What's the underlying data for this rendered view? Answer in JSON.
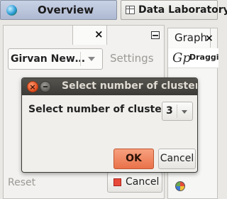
{
  "top_tabs": {
    "overview_label": "Overview",
    "data_laboratory_label": "Data Laboratory"
  },
  "left_panel": {
    "algorithm_select_value": "Girvan New…",
    "settings_label": "Settings",
    "reset_label": "Reset",
    "cancel_label": "Cancel",
    "close_glyph": "×"
  },
  "graph_panel": {
    "tab_label": "Graph",
    "close_glyph": "×",
    "toolbar_icon_glyph": "Gp",
    "toolbar_label": "Draggi"
  },
  "dialog": {
    "title": "Select number of clusters",
    "close_glyph": "×",
    "field_label": "Select number of clusters",
    "clusters_value": "3",
    "ok_label": "OK",
    "cancel_label": "Cancel"
  }
}
